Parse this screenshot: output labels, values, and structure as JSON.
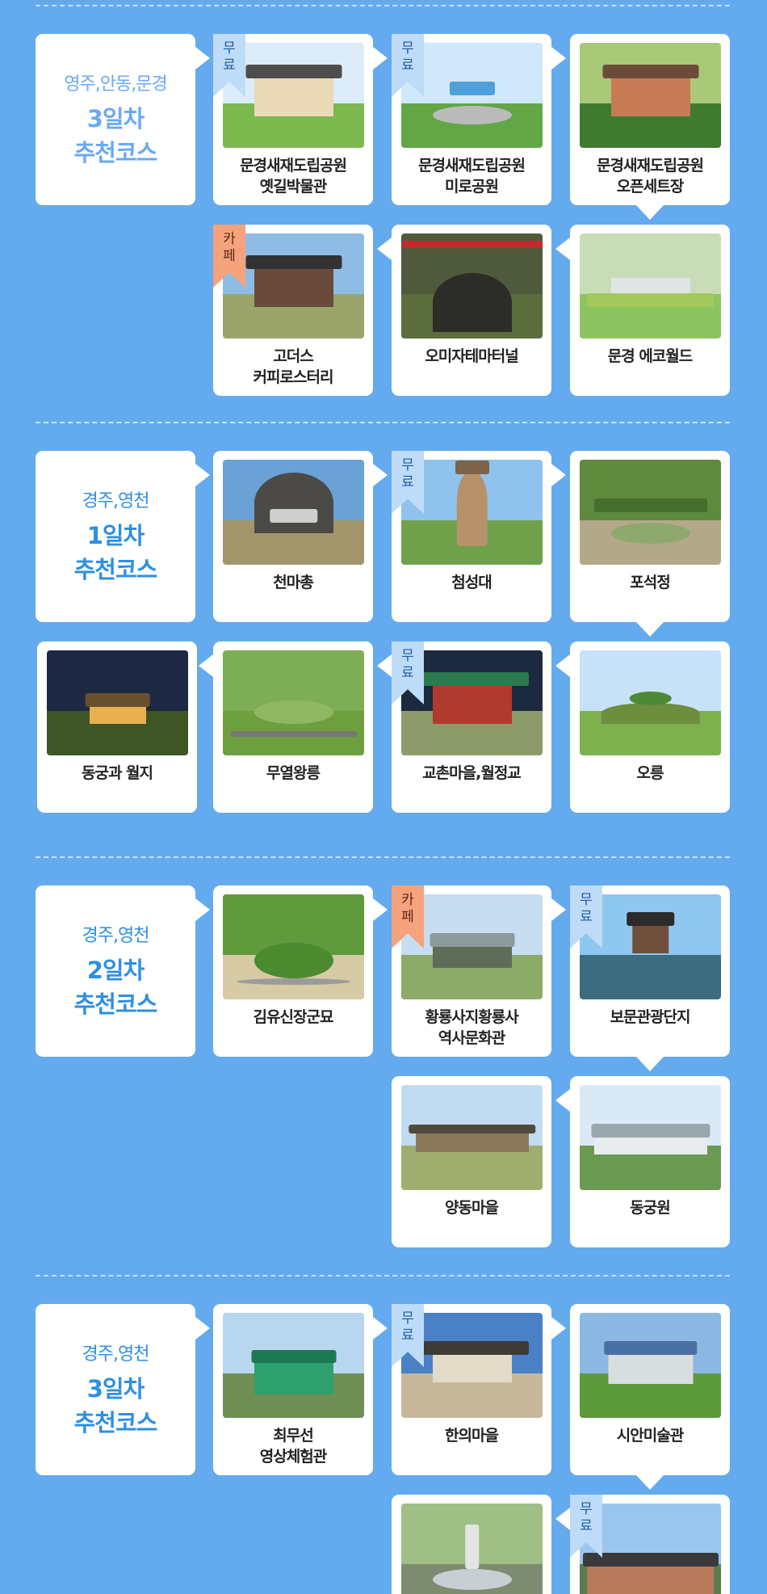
{
  "sections": [
    {
      "intro": {
        "region": "영주,안동,문경",
        "day": "3일차",
        "course": "추천코스"
      },
      "cards": [
        {
          "lines": [
            "문경새재도립공원",
            "옛길박물관"
          ],
          "tag": "무\n료",
          "tag_type": "free"
        },
        {
          "lines": [
            "문경새재도립공원",
            "미로공원"
          ],
          "tag": "무\n료",
          "tag_type": "free"
        },
        {
          "lines": [
            "문경새재도립공원",
            "오픈세트장"
          ]
        },
        {
          "lines": [
            "문경 에코월드"
          ]
        },
        {
          "lines": [
            "오미자테마터널"
          ]
        },
        {
          "lines": [
            "고더스",
            "커피로스터리"
          ],
          "tag": "카\n페",
          "tag_type": "cafe"
        }
      ]
    },
    {
      "intro": {
        "region": "경주,영천",
        "day": "1일차",
        "course": "추천코스"
      },
      "cards": [
        {
          "lines": [
            "천마총"
          ]
        },
        {
          "lines": [
            "첨성대"
          ],
          "tag": "무\n료",
          "tag_type": "free"
        },
        {
          "lines": [
            "포석정"
          ]
        },
        {
          "lines": [
            "오릉"
          ]
        },
        {
          "lines": [
            "교촌마을,월정교"
          ],
          "tag": "무\n료",
          "tag_type": "free"
        },
        {
          "lines": [
            "무열왕릉"
          ]
        },
        {
          "lines": [
            "동궁과 월지"
          ]
        }
      ]
    },
    {
      "intro": {
        "region": "경주,영천",
        "day": "2일차",
        "course": "추천코스"
      },
      "cards": [
        {
          "lines": [
            "김유신장군묘"
          ]
        },
        {
          "lines": [
            "황룡사지황룡사",
            "역사문화관"
          ],
          "tag": "카\n페",
          "tag_type": "cafe"
        },
        {
          "lines": [
            "보문관광단지"
          ],
          "tag": "무\n료",
          "tag_type": "free"
        },
        {
          "lines": [
            "동궁원"
          ]
        },
        {
          "lines": [
            "양동마을"
          ]
        }
      ]
    },
    {
      "intro": {
        "region": "경주,영천",
        "day": "3일차",
        "course": "추천코스"
      },
      "cards": [
        {
          "lines": [
            "최무선",
            "영상체험관"
          ]
        },
        {
          "lines": [
            "한의마을"
          ],
          "tag": "무\n료",
          "tag_type": "free"
        },
        {
          "lines": [
            "시안미술관"
          ]
        },
        {
          "lines": [
            ""
          ],
          "tag": "무\n료",
          "tag_type": "free"
        },
        {
          "lines": [
            ""
          ]
        }
      ]
    }
  ]
}
